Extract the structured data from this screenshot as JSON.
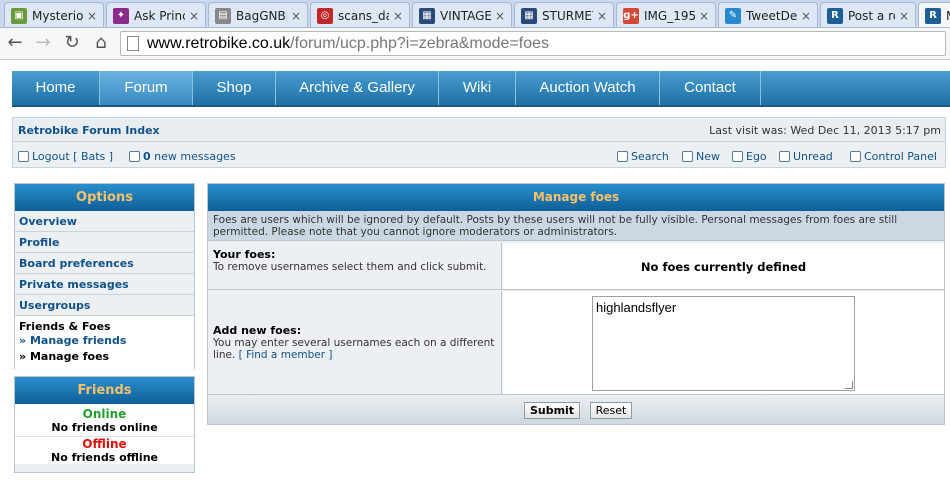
{
  "browser": {
    "tabs": [
      {
        "title": "Mysterio",
        "color": "#6a9a3a",
        "glyph": "▣",
        "icon": "image-favicon"
      },
      {
        "title": "Ask Princ",
        "color": "#8a2a8a",
        "glyph": "✦",
        "icon": "pony-favicon"
      },
      {
        "title": "BagGNBI",
        "color": "#888888",
        "glyph": "▤",
        "icon": "page-favicon"
      },
      {
        "title": "scans_da",
        "color": "#c0282a",
        "glyph": "◎",
        "icon": "debian-swirl-favicon"
      },
      {
        "title": "VINTAGE",
        "color": "#2a4a7a",
        "glyph": "▦",
        "icon": "picture-favicon"
      },
      {
        "title": "STURMEY",
        "color": "#2a4a7a",
        "glyph": "▦",
        "icon": "picture-favicon"
      },
      {
        "title": "IMG_195",
        "color": "#d34836",
        "glyph": "g+",
        "icon": "google-plus-favicon"
      },
      {
        "title": "TweetDe",
        "color": "#2a8ad0",
        "glyph": "✎",
        "icon": "tweetdeck-favicon"
      },
      {
        "title": "Post a re",
        "color": "#1d5f95",
        "glyph": "R",
        "icon": "retrobike-favicon"
      },
      {
        "title": "M",
        "color": "#1d5f95",
        "glyph": "R",
        "icon": "retrobike-favicon"
      }
    ],
    "close_glyph": "×",
    "url_domain": "www.retrobike.co.uk",
    "url_path": "/forum/ucp.php?i=zebra&mode=foes"
  },
  "nav": {
    "items": [
      "Home",
      "Forum",
      "Shop",
      "Archive & Gallery",
      "Wiki",
      "Auction Watch",
      "Contact"
    ]
  },
  "header": {
    "index": "Retrobike Forum Index",
    "last_visit": "Last visit was: Wed Dec 11, 2013 5:17 pm",
    "logout": "Logout [ Bats ]",
    "msg_count": "0",
    "msg_label": "new messages",
    "links": [
      "Search",
      "New",
      "Ego",
      "Unread",
      "Control Panel"
    ]
  },
  "options": {
    "title": "Options",
    "items": [
      "Overview",
      "Profile",
      "Board preferences",
      "Private messages",
      "Usergroups"
    ],
    "section": "Friends & Foes",
    "sub_prefix": "»",
    "sub1": "Manage friends",
    "sub2": "Manage foes"
  },
  "friends": {
    "title": "Friends",
    "online": "Online",
    "no_online": "No friends online",
    "offline": "Offline",
    "no_offline": "No friends offline"
  },
  "main": {
    "title": "Manage foes",
    "desc": "Foes are users which will be ignored by default. Posts by these users will not be fully visible. Personal messages from foes are still permitted. Please note that you cannot ignore moderators or administrators.",
    "your_foes": "Your foes:",
    "your_foes_exp": "To remove usernames select them and click submit.",
    "no_foes": "No foes currently defined",
    "add_new": "Add new foes:",
    "add_new_exp": "You may enter several usernames each on a different line.",
    "find_member": "[ Find a member ]",
    "textarea_value": "highlandsflyer",
    "submit": "Submit",
    "reset": "Reset"
  }
}
